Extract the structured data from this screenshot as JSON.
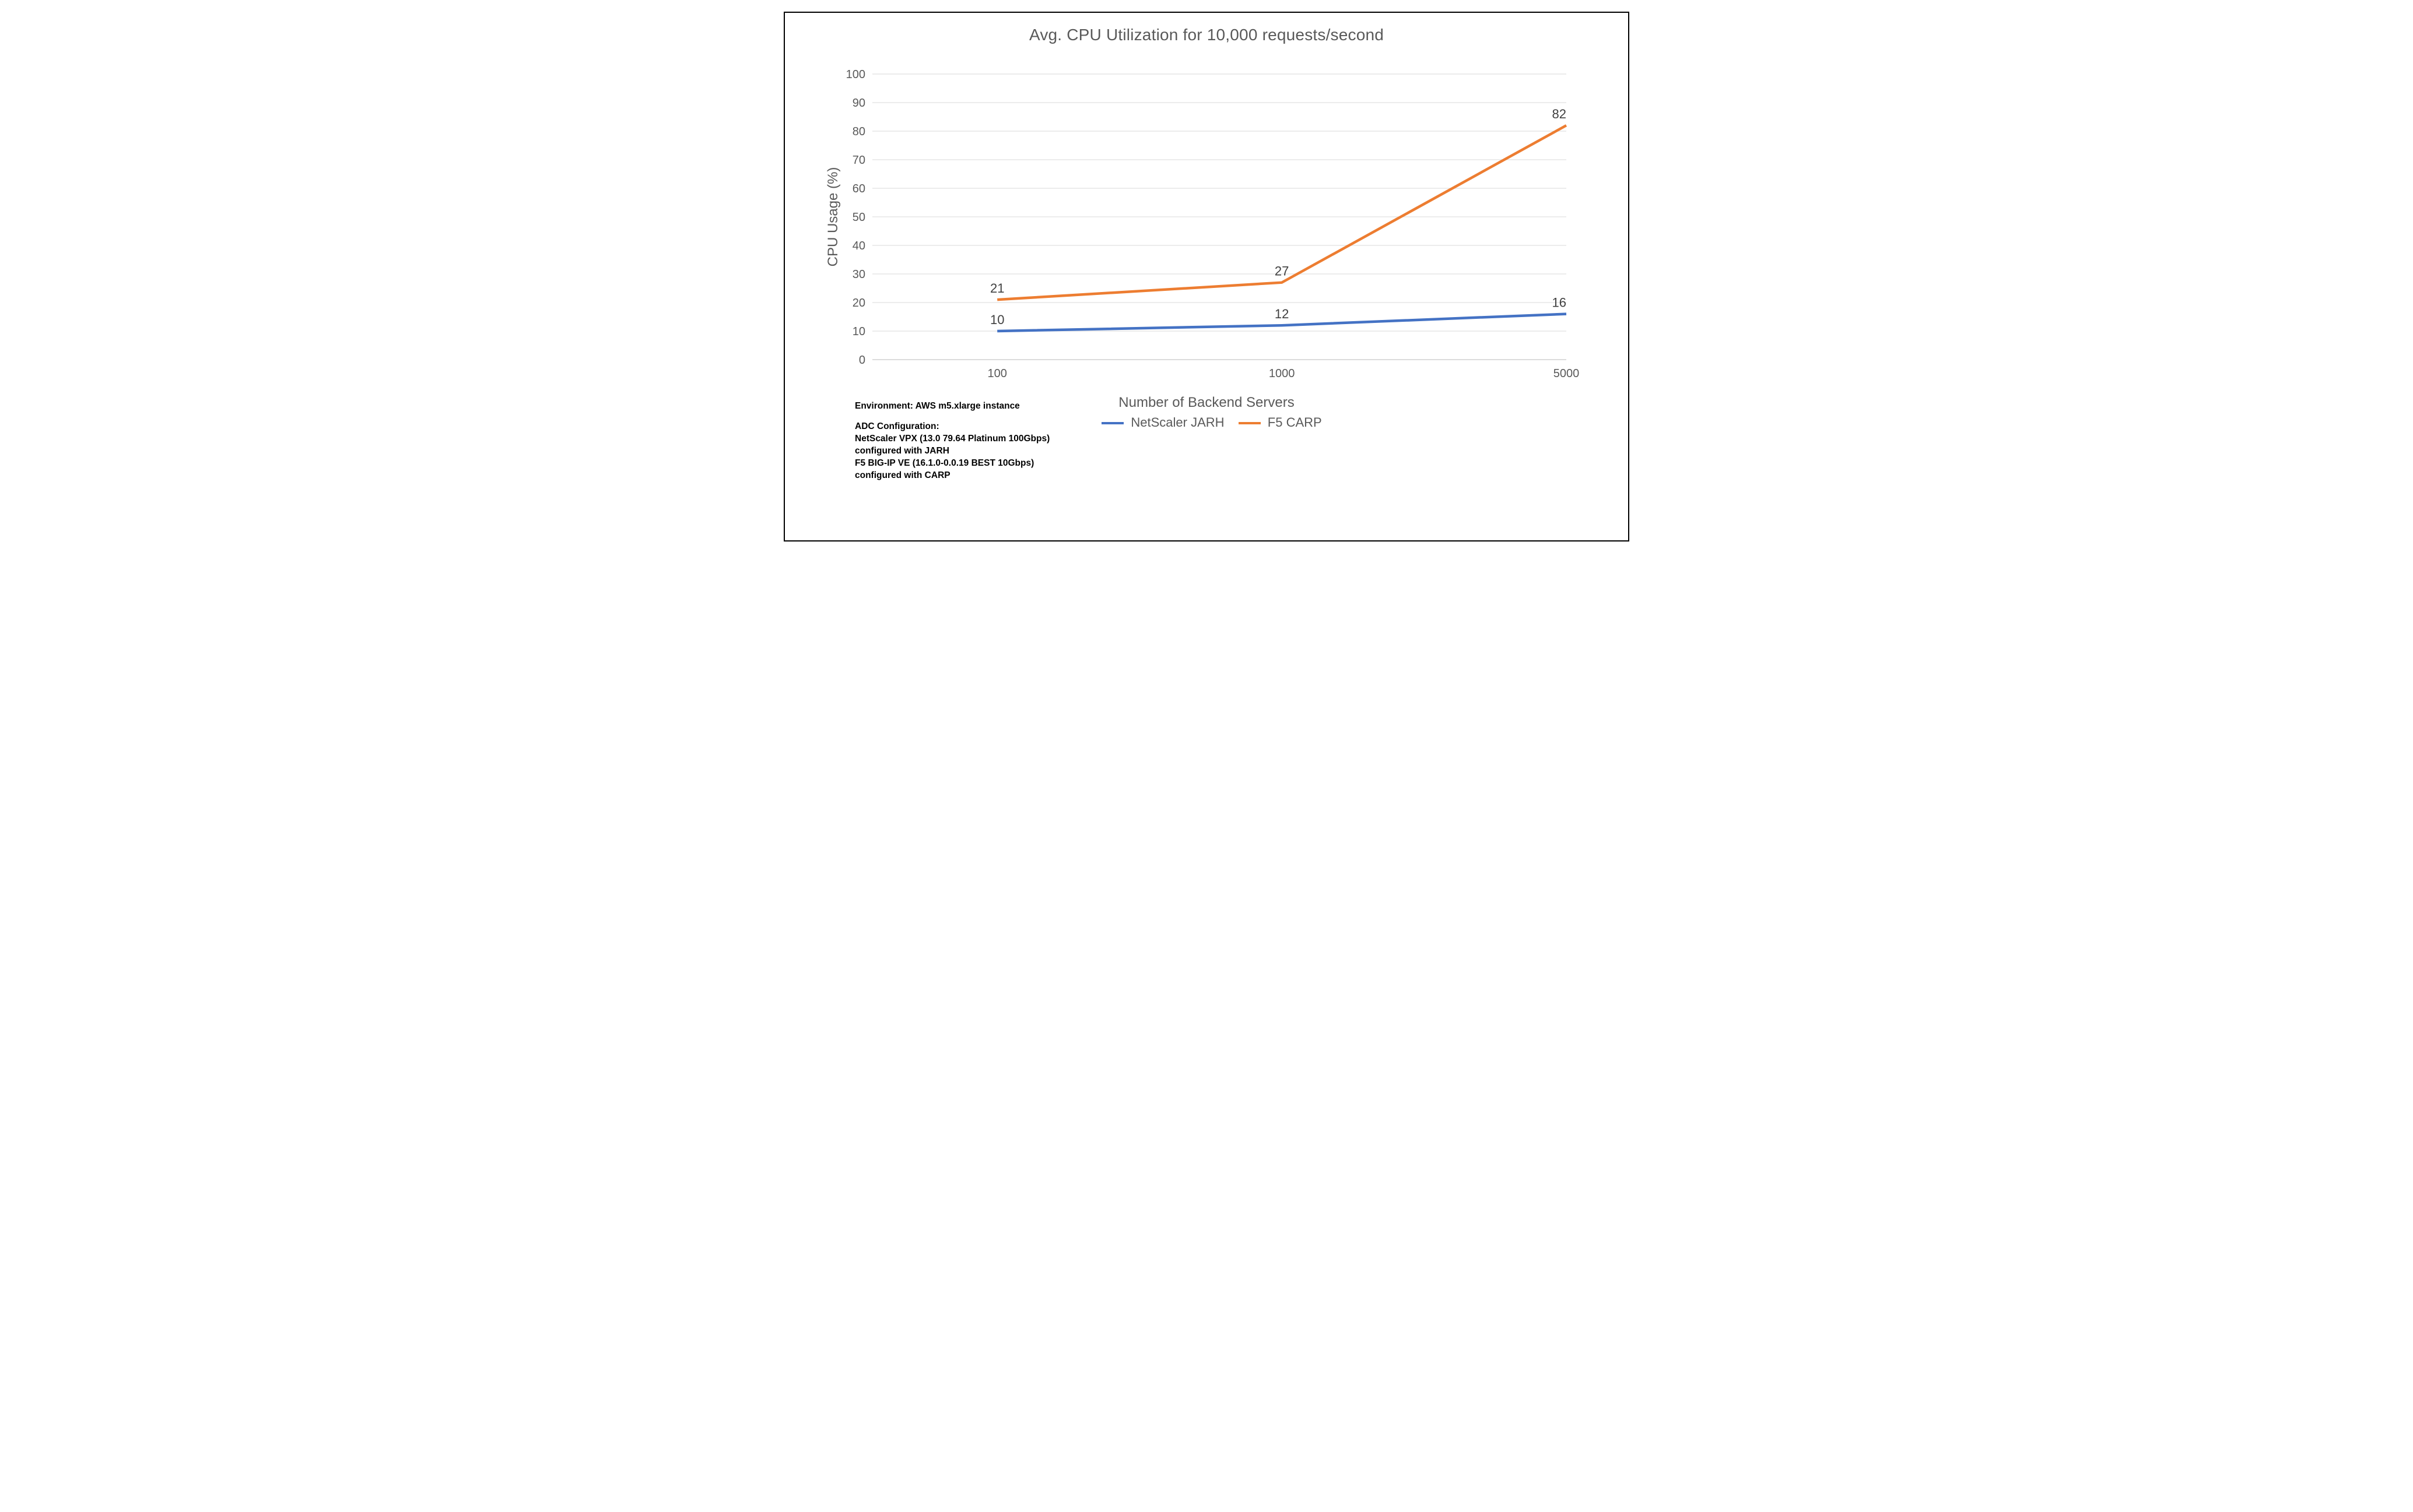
{
  "chart_data": {
    "type": "line",
    "title": "Avg. CPU Utilization for 10,000 requests/second",
    "xlabel": "Number of Backend Servers",
    "ylabel": "CPU Usage (%)",
    "categories": [
      "100",
      "1000",
      "5000"
    ],
    "ylim": [
      0,
      100
    ],
    "yticks": [
      0,
      10,
      20,
      30,
      40,
      50,
      60,
      70,
      80,
      90,
      100
    ],
    "series": [
      {
        "name": "NetScaler JARH",
        "color": "#4472C4",
        "values": [
          10,
          12,
          16
        ]
      },
      {
        "name": "F5 CARP",
        "color": "#ED7D31",
        "values": [
          21,
          27,
          82
        ]
      }
    ]
  },
  "notes": {
    "env": "Environment: AWS m5.xlarge instance",
    "adc_heading": "ADC Configuration:",
    "line1": "NetScaler VPX (13.0 79.64 Platinum 100Gbps)",
    "line2": "configured with JARH",
    "line3": "F5 BIG-IP VE (16.1.0-0.0.19 BEST 10Gbps)",
    "line4": "configured with CARP"
  }
}
